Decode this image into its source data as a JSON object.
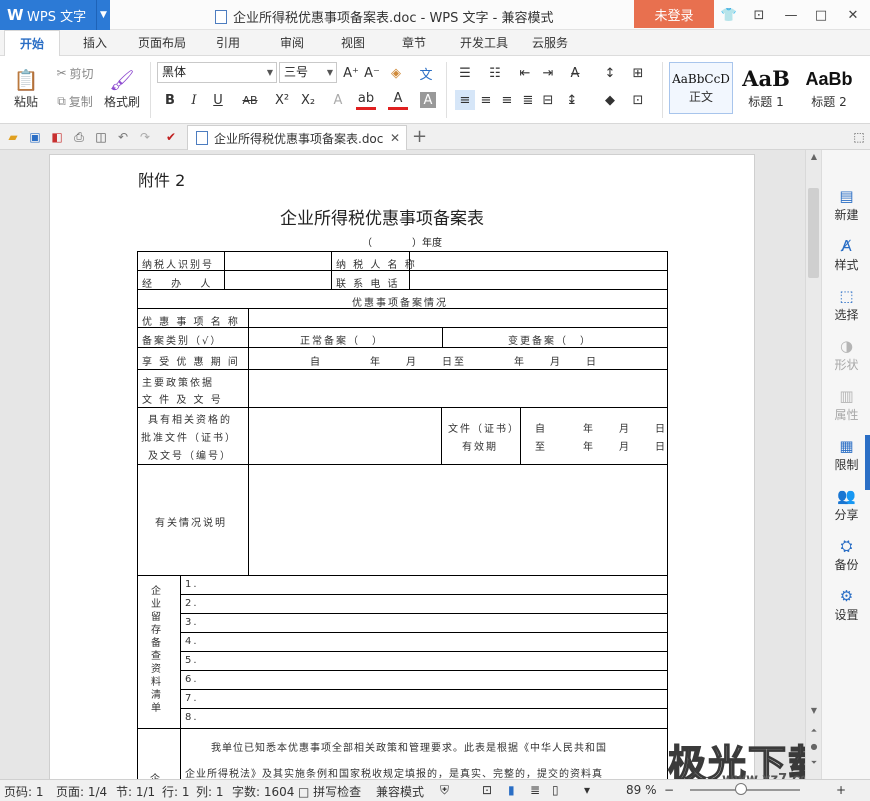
{
  "titlebar": {
    "app_name": "WPS 文字",
    "title": "企业所得税优惠事项备案表.doc - WPS 文字 - 兼容模式",
    "login_label": "未登录"
  },
  "menu": {
    "tabs": [
      "开始",
      "插入",
      "页面布局",
      "引用",
      "审阅",
      "视图",
      "章节",
      "开发工具",
      "云服务"
    ],
    "active": "开始"
  },
  "ribbon": {
    "paste_label": "粘贴",
    "cut_label": "剪切",
    "copy_label": "复制",
    "format_painter_label": "格式刷",
    "font_name": "黑体",
    "font_size": "三号",
    "styles": [
      {
        "preview": "AaBbCcD",
        "name": "正文"
      },
      {
        "preview": "AaB",
        "name": "标题 1"
      },
      {
        "preview": "AaBb",
        "name": "标题 2"
      }
    ]
  },
  "doc_tab": {
    "name": "企业所得税优惠事项备案表.doc"
  },
  "document": {
    "attachment": "附件 2",
    "title": "企业所得税优惠事项备案表",
    "year_line": "（　　　　）年度",
    "taxpayer_id": "纳税人识别号",
    "taxpayer_name": "纳 税 人 名 称",
    "handler": "经　 办　 人",
    "phone": "联 系 电 话",
    "section": "优惠事项备案情况",
    "item_name": "优 惠 事 项 名 称",
    "category": "备案类别（√）",
    "normal": "正常备案（　）",
    "change": "变更备案（　）",
    "period": "享 受 优 惠 期 间",
    "period_value": "自　　　　年　　月　　日至　　　　年　　月　　日",
    "policy_1": "主要政策依据",
    "policy_2": "文 件 及 文 号",
    "qual_1": "具有相关资格的",
    "qual_2": "批准文件（证书）",
    "qual_3": "及文号（编号）",
    "valid_1": "文件（证书）",
    "valid_2": "有效期",
    "from_line": "自　　　年　　月　　日",
    "to_line": "至　　　年　　月　　日",
    "notes": "有关情况说明",
    "retained_list": "企业留存备查资料清单",
    "rows": [
      "1.",
      "2.",
      "3.",
      "4.",
      "5.",
      "6.",
      "7.",
      "8."
    ],
    "declaration_1": "我单位已知悉本优惠事项全部相关政策和管理要求。此表是根据《中华人民共和国",
    "declaration_2": "企业所得税法》及其实施条例和国家税收规定填报的，是真实、完整的，提交的资料真",
    "declaration_label": "企"
  },
  "sidebar": {
    "items": [
      {
        "label": "新建",
        "enabled": true
      },
      {
        "label": "样式",
        "enabled": true
      },
      {
        "label": "选择",
        "enabled": true
      },
      {
        "label": "形状",
        "enabled": false
      },
      {
        "label": "属性",
        "enabled": false
      },
      {
        "label": "限制",
        "enabled": true
      },
      {
        "label": "分享",
        "enabled": true
      },
      {
        "label": "备份",
        "enabled": true
      },
      {
        "label": "设置",
        "enabled": true
      }
    ]
  },
  "status": {
    "page_code": "页码: 1",
    "page": "页面: 1/4",
    "section": "节: 1/1",
    "row": "行: 1",
    "col": "列: 1",
    "words": "字数: 1604",
    "spell": "拼写检查",
    "compat": "兼容模式",
    "zoom": "89 %"
  },
  "watermark": {
    "text": "极光下载",
    "site": "www.xz7.com"
  }
}
